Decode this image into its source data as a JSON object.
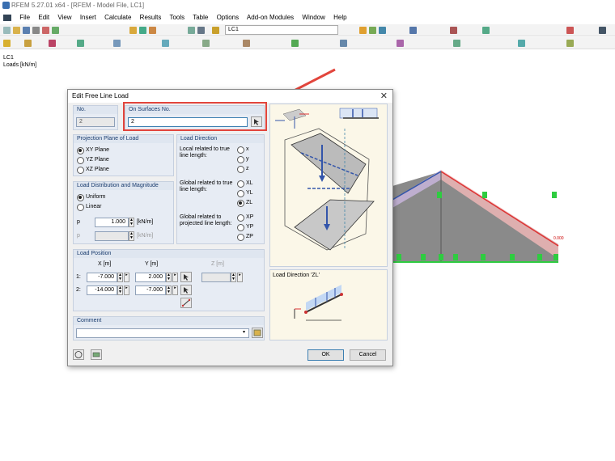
{
  "app": {
    "title": "RFEM 5.27.01 x64 - [RFEM - Model File, LC1]"
  },
  "menu": [
    "File",
    "Edit",
    "View",
    "Insert",
    "Calculate",
    "Results",
    "Tools",
    "Table",
    "Options",
    "Add-on Modules",
    "Window",
    "Help"
  ],
  "toolbar": {
    "load_case": "LC1"
  },
  "canvas": {
    "load_case_label": "LC1",
    "load_units_label": "Loads [kN/m]",
    "node_label": "0.000"
  },
  "dialog": {
    "title": "Edit Free Line Load",
    "no": {
      "label": "No.",
      "value": "2"
    },
    "surfaces": {
      "label": "On Surfaces No.",
      "value": "2"
    },
    "projection": {
      "label": "Projection Plane of Load",
      "options": [
        "XY Plane",
        "YZ Plane",
        "XZ Plane"
      ],
      "selected": 0
    },
    "direction": {
      "label": "Load Direction",
      "local_label": "Local related to true line length:",
      "global_true_label": "Global related to true line length:",
      "global_proj_label": "Global related to projected line length:",
      "local_opts": [
        "x",
        "y",
        "z"
      ],
      "global_true_opts": [
        "XL",
        "YL",
        "ZL"
      ],
      "global_proj_opts": [
        "XP",
        "YP",
        "ZP"
      ],
      "selected": "ZL"
    },
    "distribution": {
      "label": "Load Distribution and Magnitude",
      "options": [
        "Uniform",
        "Linear"
      ],
      "selected": 0,
      "p_label": "p",
      "p_value": "1.000",
      "p_unit": "[kN/m]",
      "p2_label": "p",
      "p2_value": "",
      "p2_unit": "[kN/m]"
    },
    "position": {
      "label": "Load Position",
      "col_x": "X [m]",
      "col_y": "Y [m]",
      "col_z": "Z [m]",
      "rows": [
        {
          "label": "1:",
          "x": "-7.000",
          "y": "2.000"
        },
        {
          "label": "2:",
          "x": "-14.000",
          "y": "-7.000"
        }
      ]
    },
    "comment": {
      "label": "Comment",
      "value": ""
    },
    "preview_caption": "Load Direction 'ZL'",
    "buttons": {
      "ok": "OK",
      "cancel": "Cancel"
    }
  },
  "colors": {
    "accent": "#e2453c",
    "support": "#2ecc40",
    "load": "#3355aa"
  }
}
